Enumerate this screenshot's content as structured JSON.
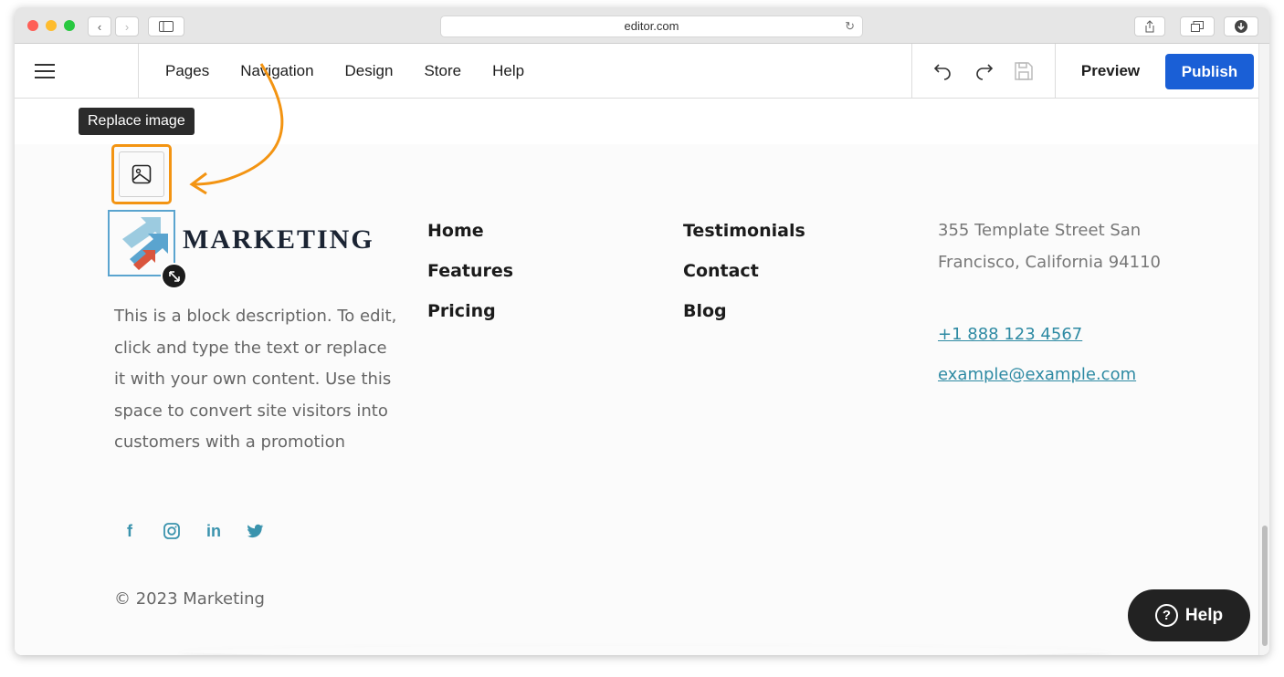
{
  "browser": {
    "url": "editor.com"
  },
  "toolbar": {
    "nav": [
      "Pages",
      "Navigation",
      "Design",
      "Store",
      "Help"
    ],
    "preview_label": "Preview",
    "publish_label": "Publish"
  },
  "editor": {
    "tooltip": "Replace image"
  },
  "footer": {
    "brand": "MARKETING",
    "description": "This is a block description. To edit, click and type the text or replace it with your own content. Use this space to convert site visitors into customers with a promotion",
    "links_col1": [
      "Home",
      "Features",
      "Pricing"
    ],
    "links_col2": [
      "Testimonials",
      "Contact",
      "Blog"
    ],
    "address": "355 Template Street San Francisco, California 94110",
    "phone": "+1 888 123 4567",
    "email": "example@example.com",
    "social_icons": [
      "facebook-icon",
      "instagram-icon",
      "linkedin-icon",
      "twitter-icon"
    ],
    "copyright": "© 2023 Marketing"
  },
  "help_button": {
    "label": "Help"
  },
  "colors": {
    "publish": "#1a5fd6",
    "highlight": "#f39412",
    "link": "#2e8aa3"
  }
}
